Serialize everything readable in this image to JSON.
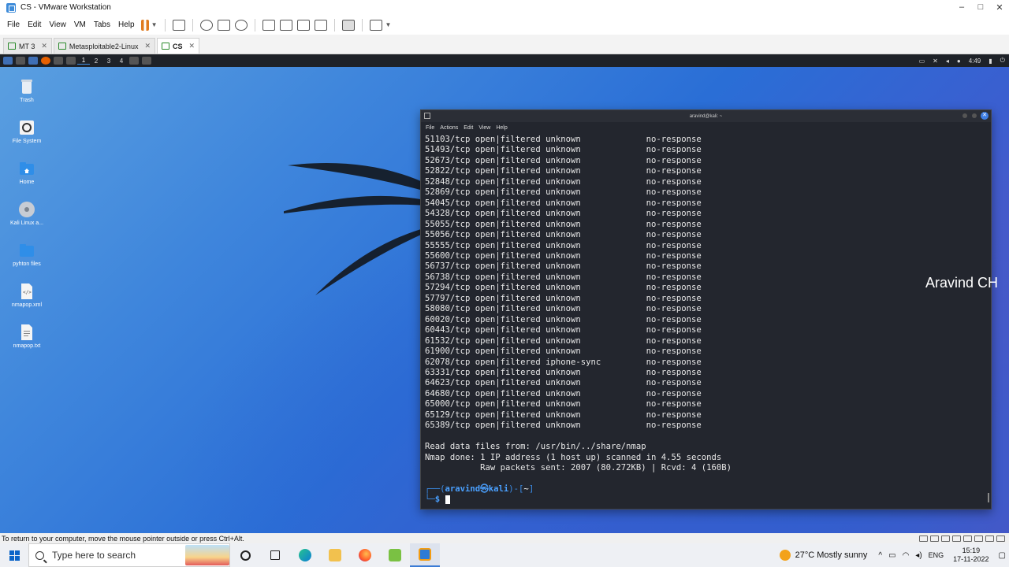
{
  "window": {
    "title": "CS - VMware Workstation",
    "controls": [
      "–",
      "□",
      "✕"
    ]
  },
  "menu": [
    "File",
    "Edit",
    "View",
    "VM",
    "Tabs",
    "Help"
  ],
  "tabs": [
    {
      "label": "MT 3",
      "active": false
    },
    {
      "label": "Metasploitable2-Linux",
      "active": false
    },
    {
      "label": "CS",
      "active": true
    }
  ],
  "kali_panel": {
    "workspaces": [
      "1",
      "2",
      "3",
      "4"
    ],
    "time": "4:49"
  },
  "desktop_icons": [
    "Trash",
    "File System",
    "Home",
    "Kali Linux a...",
    "pyhton files",
    "nmapop.xml",
    "nmapop.txt"
  ],
  "terminal": {
    "title": "aravind@kali: ~",
    "menu": [
      "File",
      "Actions",
      "Edit",
      "View",
      "Help"
    ],
    "ports": [
      [
        "51103/tcp",
        "open|filtered",
        "unknown",
        "no-response"
      ],
      [
        "51493/tcp",
        "open|filtered",
        "unknown",
        "no-response"
      ],
      [
        "52673/tcp",
        "open|filtered",
        "unknown",
        "no-response"
      ],
      [
        "52822/tcp",
        "open|filtered",
        "unknown",
        "no-response"
      ],
      [
        "52848/tcp",
        "open|filtered",
        "unknown",
        "no-response"
      ],
      [
        "52869/tcp",
        "open|filtered",
        "unknown",
        "no-response"
      ],
      [
        "54045/tcp",
        "open|filtered",
        "unknown",
        "no-response"
      ],
      [
        "54328/tcp",
        "open|filtered",
        "unknown",
        "no-response"
      ],
      [
        "55055/tcp",
        "open|filtered",
        "unknown",
        "no-response"
      ],
      [
        "55056/tcp",
        "open|filtered",
        "unknown",
        "no-response"
      ],
      [
        "55555/tcp",
        "open|filtered",
        "unknown",
        "no-response"
      ],
      [
        "55600/tcp",
        "open|filtered",
        "unknown",
        "no-response"
      ],
      [
        "56737/tcp",
        "open|filtered",
        "unknown",
        "no-response"
      ],
      [
        "56738/tcp",
        "open|filtered",
        "unknown",
        "no-response"
      ],
      [
        "57294/tcp",
        "open|filtered",
        "unknown",
        "no-response"
      ],
      [
        "57797/tcp",
        "open|filtered",
        "unknown",
        "no-response"
      ],
      [
        "58080/tcp",
        "open|filtered",
        "unknown",
        "no-response"
      ],
      [
        "60020/tcp",
        "open|filtered",
        "unknown",
        "no-response"
      ],
      [
        "60443/tcp",
        "open|filtered",
        "unknown",
        "no-response"
      ],
      [
        "61532/tcp",
        "open|filtered",
        "unknown",
        "no-response"
      ],
      [
        "61900/tcp",
        "open|filtered",
        "unknown",
        "no-response"
      ],
      [
        "62078/tcp",
        "open|filtered",
        "iphone-sync",
        "no-response"
      ],
      [
        "63331/tcp",
        "open|filtered",
        "unknown",
        "no-response"
      ],
      [
        "64623/tcp",
        "open|filtered",
        "unknown",
        "no-response"
      ],
      [
        "64680/tcp",
        "open|filtered",
        "unknown",
        "no-response"
      ],
      [
        "65000/tcp",
        "open|filtered",
        "unknown",
        "no-response"
      ],
      [
        "65129/tcp",
        "open|filtered",
        "unknown",
        "no-response"
      ],
      [
        "65389/tcp",
        "open|filtered",
        "unknown",
        "no-response"
      ]
    ],
    "footer": [
      "Read data files from: /usr/bin/../share/nmap",
      "Nmap done: 1 IP address (1 host up) scanned in 4.55 seconds",
      "           Raw packets sent: 2007 (80.272KB) | Rcvd: 4 (160B)"
    ],
    "prompt_user": "aravind㉿kali",
    "prompt_dir": "~"
  },
  "watermark": "Aravind CH",
  "status_message": "To return to your computer, move the mouse pointer outside or press Ctrl+Alt.",
  "taskbar": {
    "search_placeholder": "Type here to search",
    "weather": "27°C  Mostly sunny",
    "lang": "ENG",
    "time": "15:19",
    "date": "17-11-2022"
  }
}
